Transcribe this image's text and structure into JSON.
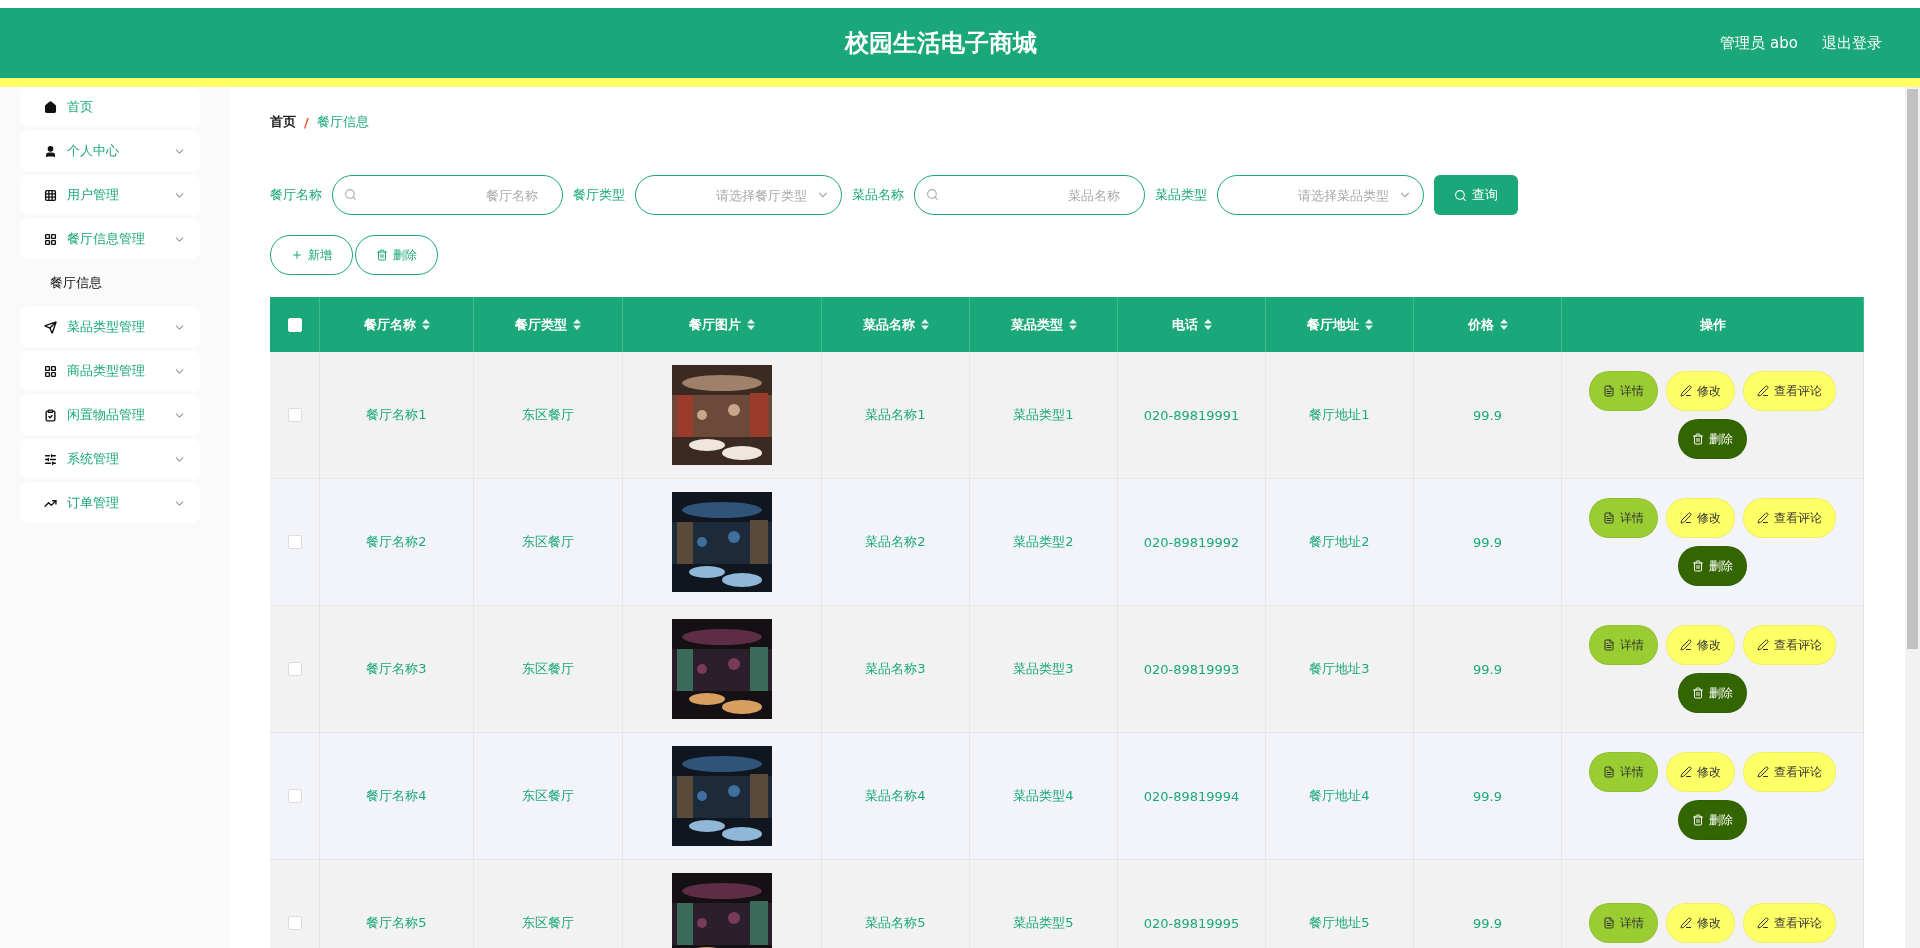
{
  "header": {
    "title": "校园生活电子商城",
    "user": "管理员 abo",
    "logout": "退出登录"
  },
  "sidebar": {
    "items": [
      {
        "label": "首页",
        "kind": "link"
      },
      {
        "label": "个人中心",
        "kind": "menu"
      },
      {
        "label": "用户管理",
        "kind": "menu"
      },
      {
        "label": "餐厅信息管理",
        "kind": "menu",
        "children": [
          {
            "label": "餐厅信息"
          }
        ]
      },
      {
        "label": "菜品类型管理",
        "kind": "menu"
      },
      {
        "label": "商品类型管理",
        "kind": "menu"
      },
      {
        "label": "闲置物品管理",
        "kind": "menu"
      },
      {
        "label": "系统管理",
        "kind": "menu"
      },
      {
        "label": "订单管理",
        "kind": "menu"
      }
    ]
  },
  "breadcrumb": {
    "separator": "/",
    "items": [
      {
        "label": "首页"
      },
      {
        "label": "餐厅信息"
      }
    ]
  },
  "filters": [
    {
      "label": "餐厅名称",
      "kind": "search",
      "placeholder": "餐厅名称"
    },
    {
      "label": "餐厅类型",
      "kind": "select",
      "placeholder": "请选择餐厅类型"
    },
    {
      "label": "菜品名称",
      "kind": "search",
      "placeholder": "菜品名称"
    },
    {
      "label": "菜品类型",
      "kind": "select",
      "placeholder": "请选择菜品类型"
    }
  ],
  "query_button": "查询",
  "toolbar": [
    {
      "label": "新增",
      "kind": "add"
    },
    {
      "label": "删除",
      "kind": "delete"
    }
  ],
  "table": {
    "select_all_checked": false,
    "columns": [
      {
        "label": "餐厅名称",
        "sortable": true
      },
      {
        "label": "餐厅类型",
        "sortable": true
      },
      {
        "label": "餐厅图片",
        "sortable": true
      },
      {
        "label": "菜品名称",
        "sortable": true
      },
      {
        "label": "菜品类型",
        "sortable": true
      },
      {
        "label": "电话",
        "sortable": true
      },
      {
        "label": "餐厅地址",
        "sortable": true
      },
      {
        "label": "价格",
        "sortable": true
      },
      {
        "label": "操作",
        "sortable": false
      }
    ],
    "rows": [
      {
        "checked": false,
        "cells": [
          "餐厅名称1",
          "东区餐厅",
          {
            "kind": "picture"
          },
          "菜品名称1",
          "菜品类型1",
          "020-89819991",
          "餐厅地址1",
          "99.9"
        ],
        "actions": [
          {
            "label": "详情",
            "kind": "detail"
          },
          {
            "label": "修改",
            "kind": "edit"
          },
          {
            "label": "查看评论",
            "kind": "comments"
          },
          {
            "label": "删除",
            "kind": "delete"
          }
        ]
      },
      {
        "checked": false,
        "cells": [
          "餐厅名称2",
          "东区餐厅",
          {
            "kind": "picture"
          },
          "菜品名称2",
          "菜品类型2",
          "020-89819992",
          "餐厅地址2",
          "99.9"
        ],
        "actions": [
          {
            "label": "详情",
            "kind": "detail"
          },
          {
            "label": "修改",
            "kind": "edit"
          },
          {
            "label": "查看评论",
            "kind": "comments"
          },
          {
            "label": "删除",
            "kind": "delete"
          }
        ]
      },
      {
        "checked": false,
        "cells": [
          "餐厅名称3",
          "东区餐厅",
          {
            "kind": "picture"
          },
          "菜品名称3",
          "菜品类型3",
          "020-89819993",
          "餐厅地址3",
          "99.9"
        ],
        "actions": [
          {
            "label": "详情",
            "kind": "detail"
          },
          {
            "label": "修改",
            "kind": "edit"
          },
          {
            "label": "查看评论",
            "kind": "comments"
          },
          {
            "label": "删除",
            "kind": "delete"
          }
        ]
      },
      {
        "checked": false,
        "cells": [
          "餐厅名称4",
          "东区餐厅",
          {
            "kind": "picture"
          },
          "菜品名称4",
          "菜品类型4",
          "020-89819994",
          "餐厅地址4",
          "99.9"
        ],
        "actions": [
          {
            "label": "详情",
            "kind": "detail"
          },
          {
            "label": "修改",
            "kind": "edit"
          },
          {
            "label": "查看评论",
            "kind": "comments"
          },
          {
            "label": "删除",
            "kind": "delete"
          }
        ]
      },
      {
        "checked": false,
        "cells": [
          "餐厅名称5",
          "东区餐厅",
          {
            "kind": "picture"
          },
          "菜品名称5",
          "菜品类型5",
          "020-89819995",
          "餐厅地址5",
          "99.9"
        ],
        "actions": [
          {
            "label": "详情",
            "kind": "detail"
          },
          {
            "label": "修改",
            "kind": "edit"
          },
          {
            "label": "查看评论",
            "kind": "comments"
          }
        ]
      }
    ]
  }
}
